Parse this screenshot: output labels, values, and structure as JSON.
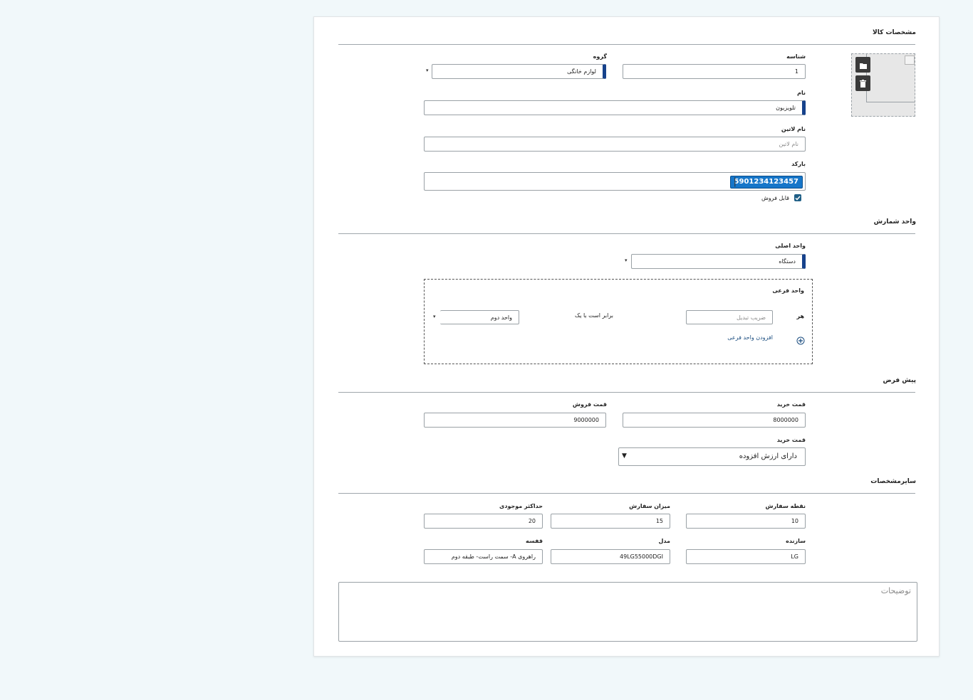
{
  "product": {
    "section_title": "مشخصات کالا",
    "id": {
      "label": "شناسه",
      "value": "1"
    },
    "group": {
      "label": "گروه",
      "value": "لوازم خانگی"
    },
    "name": {
      "label": "نام",
      "value": "تلویزیون"
    },
    "latin_name": {
      "label": "نام لاتین",
      "placeholder": "نام لاتین"
    },
    "barcode": {
      "label": "بارکد",
      "value": "5901234123457"
    },
    "sellable": {
      "label": "قابل فروش",
      "checked": true
    },
    "image": {
      "folder_icon": "folder-icon",
      "delete_icon": "trash-icon"
    }
  },
  "units": {
    "section_title": "واحد شمارش",
    "main_unit": {
      "label": "واحد اصلی",
      "value": "دستگاه"
    },
    "sub_unit": {
      "title": "واحد فرعی",
      "each_label": "هر",
      "factor_placeholder": "ضریب تبدیل",
      "equals_text": "برابر است با یک",
      "second_unit_value": "واحد دوم",
      "add_label": "افزودن واحد فرعی"
    }
  },
  "defaults": {
    "section_title": "پیش فرض",
    "purchase_price": {
      "label": "قمت خرید",
      "value": "8000000"
    },
    "sale_price": {
      "label": "قمت فروش",
      "value": "9000000"
    },
    "tax_type": {
      "label": "قمت خرید",
      "value": "دارای ارزش افزوده"
    }
  },
  "other": {
    "section_title": "سایرمشخصات",
    "reorder_point": {
      "label": "نقطه سفارش",
      "value": "10"
    },
    "order_quantity": {
      "label": "میزان سفارش",
      "value": "15"
    },
    "max_stock": {
      "label": "حداکثر موجودی",
      "value": "20"
    },
    "manufacturer": {
      "label": "سازنده",
      "value": "LG"
    },
    "model": {
      "label": "مدل",
      "value": "49LG55000DGI"
    },
    "shelf": {
      "label": "قفسه",
      "value": "راهروی A- سمت راست- طبقه دوم"
    },
    "description": {
      "placeholder": "توضیحات"
    }
  },
  "colors": {
    "accent": "#16428b",
    "chip": "#1676c9",
    "checkbox": "#1f5f86",
    "link": "#1c4e80",
    "background": "#f1f8fa"
  }
}
